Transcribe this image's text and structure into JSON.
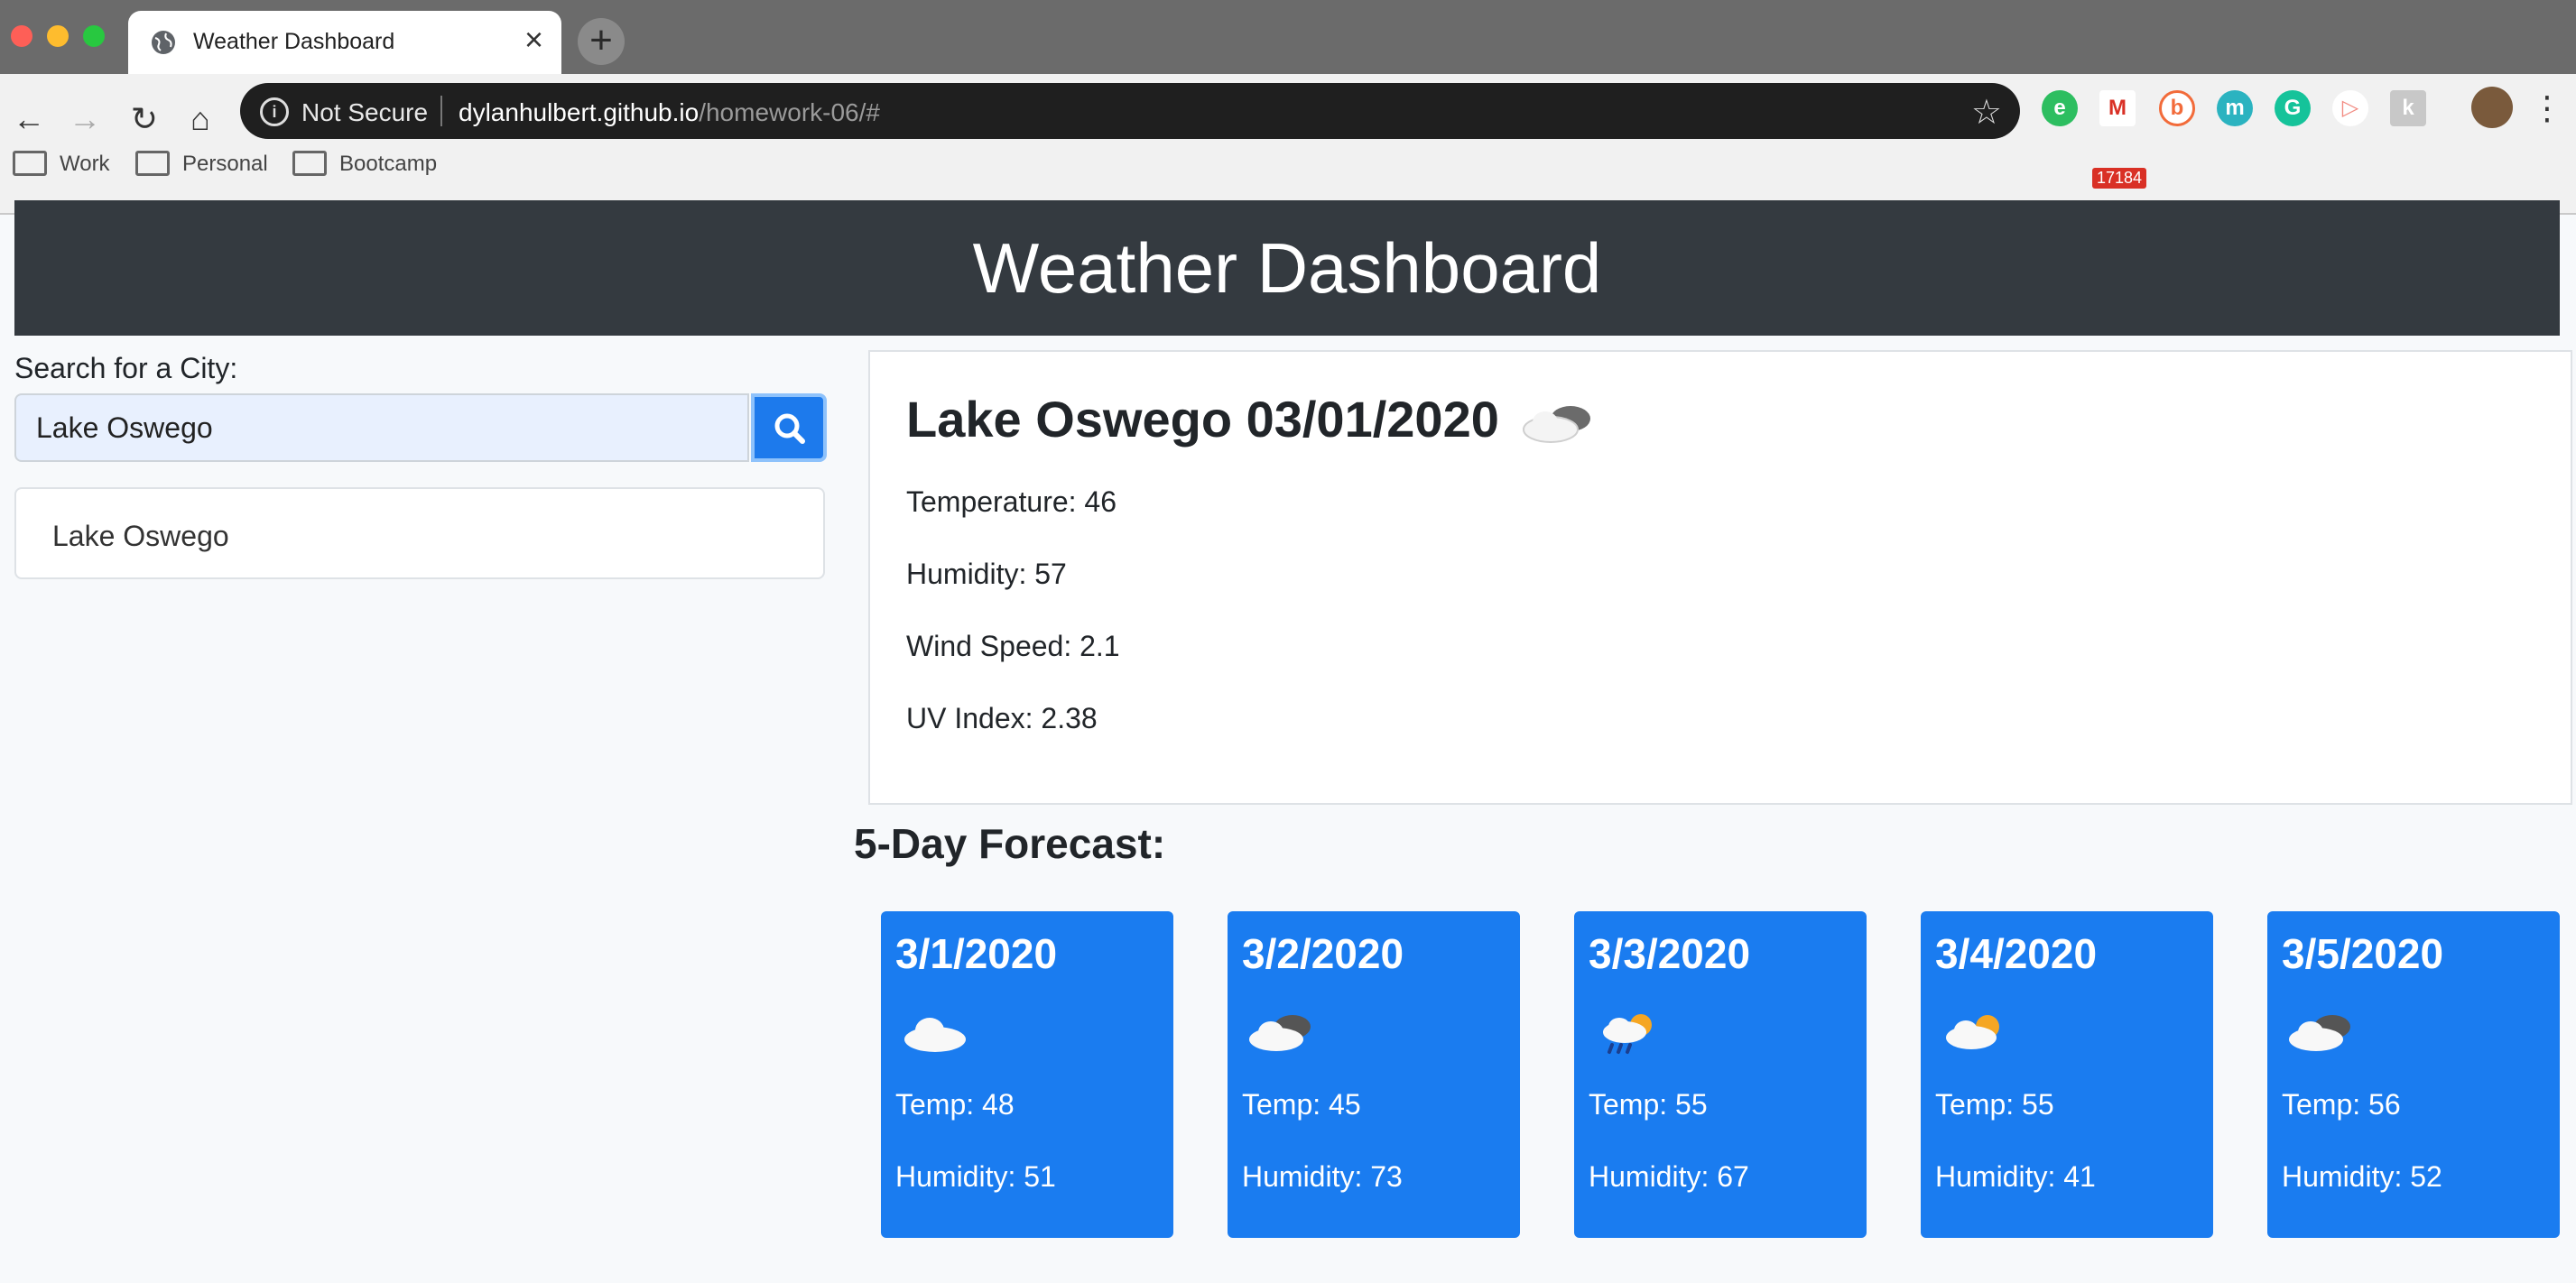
{
  "browser": {
    "tab_title": "Weather Dashboard",
    "security_label": "Not Secure",
    "url_host": "dylanhulbert.github.io",
    "url_path": "/homework-06/#",
    "ext_badge_count": "17184",
    "bookmarks": [
      "Work",
      "Personal",
      "Bootcamp"
    ]
  },
  "header": {
    "title": "Weather Dashboard"
  },
  "sidebar": {
    "search_label": "Search for a City:",
    "search_value": "Lake Oswego",
    "history": [
      "Lake Oswego"
    ]
  },
  "current": {
    "city_date": "Lake Oswego 03/01/2020",
    "icon": "cloudy-icon",
    "temperature": "Temperature: 46",
    "humidity": "Humidity: 57",
    "wind": "Wind Speed: 2.1",
    "uv": "UV Index: 2.38"
  },
  "forecast": {
    "title": "5-Day Forecast:",
    "days": [
      {
        "date": "3/1/2020",
        "icon": "cloud-icon",
        "temp": "Temp: 48",
        "humidity": "Humidity: 51"
      },
      {
        "date": "3/2/2020",
        "icon": "broken-clouds-icon",
        "temp": "Temp: 45",
        "humidity": "Humidity: 73"
      },
      {
        "date": "3/3/2020",
        "icon": "rain-sun-icon",
        "temp": "Temp: 55",
        "humidity": "Humidity: 67"
      },
      {
        "date": "3/4/2020",
        "icon": "partly-cloudy-icon",
        "temp": "Temp: 55",
        "humidity": "Humidity: 41"
      },
      {
        "date": "3/5/2020",
        "icon": "broken-clouds-icon",
        "temp": "Temp: 56",
        "humidity": "Humidity: 52"
      }
    ]
  }
}
